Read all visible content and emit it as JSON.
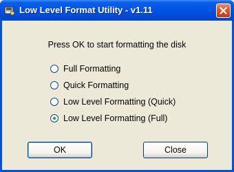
{
  "window": {
    "title": "Low Level Format Utility - v1.11",
    "close_icon": "close-icon",
    "app_icon": "disk-utility-icon"
  },
  "dialog": {
    "prompt": "Press OK to start formatting the disk",
    "options": [
      {
        "label": "Full Formatting",
        "checked": false
      },
      {
        "label": "Quick Formatting",
        "checked": false
      },
      {
        "label": "Low Level Formatting (Quick)",
        "checked": false
      },
      {
        "label": "Low Level Formatting (Full)",
        "checked": true
      }
    ],
    "ok_label": "OK",
    "close_label": "Close"
  },
  "colors": {
    "titlebar": "#0055e5",
    "face": "#ece9d8",
    "radio_dot": "#21a121",
    "close_button": "#d9532a"
  }
}
